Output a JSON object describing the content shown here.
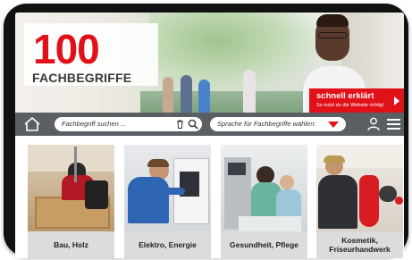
{
  "logo": {
    "number": "100",
    "word": "FACHBEGRIFFE"
  },
  "promo": {
    "title": "schnell erklärt",
    "subtitle": "So nutzt du die Website richtig!"
  },
  "navbar": {
    "search": {
      "placeholder": "Fachbegriff suchen ..."
    },
    "language": {
      "placeholder": "Sprache für Fachbegriffe wählen:"
    }
  },
  "categories": [
    {
      "label": "Bau, Holz"
    },
    {
      "label": "Elektro, Energie"
    },
    {
      "label": "Gesundheit, Pflege"
    },
    {
      "label": "Kosmetik, Friseurhandwerk"
    }
  ],
  "colors": {
    "accent": "#e1111a",
    "navbar": "#5a5f63",
    "card": "#dcdcdc"
  },
  "icons": [
    "home-icon",
    "trash-icon",
    "search-icon",
    "chevron-down-icon",
    "user-icon",
    "menu-icon",
    "arrow-right-icon"
  ]
}
